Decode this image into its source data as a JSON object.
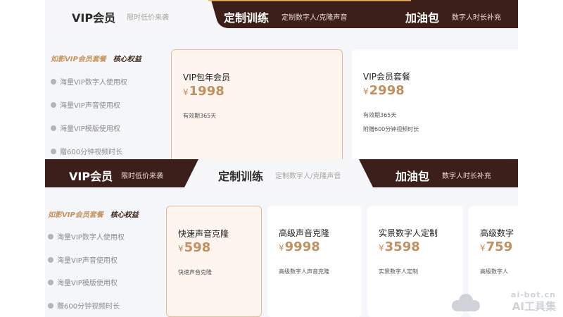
{
  "top": {
    "tabs": [
      {
        "title": "VIP会员",
        "subtitle": "限时低价来袭"
      },
      {
        "title": "定制训练",
        "subtitle": "定制数字人/克隆声音"
      },
      {
        "title": "加油包",
        "subtitle": "数字人时长补充"
      }
    ],
    "brand": "如影VIP会员套餐",
    "brand_core": "核心权益",
    "benefits": [
      "海量VIP数字人使用权",
      "海量VIP声音使用权",
      "海量VIP模版使用权",
      "赠600分钟视频时长"
    ],
    "cards": [
      {
        "name": "VIP包年会员",
        "currency": "¥",
        "price": "1998",
        "desc1": "有效期365天",
        "desc2": ""
      },
      {
        "name": "VIP会员套餐",
        "currency": "¥",
        "price": "2998",
        "desc1": "有效期365天",
        "desc2": "附赠600分钟视频时长"
      }
    ]
  },
  "bottom": {
    "tabs": [
      {
        "title": "VIP会员",
        "subtitle": "限时低价来袭"
      },
      {
        "title": "定制训练",
        "subtitle": "定制数字人/克隆声音"
      },
      {
        "title": "加油包",
        "subtitle": "数字人时长补充"
      }
    ],
    "brand": "如影VIP会员套餐",
    "brand_core": "核心权益",
    "benefits": [
      "海量VIP数字人使用权",
      "海量VIP声音使用权",
      "海量VIP模版使用权",
      "赠600分钟视频时长"
    ],
    "cards": [
      {
        "name": "快速声音克隆",
        "currency": "¥",
        "price": "598",
        "desc": "快速声音克隆"
      },
      {
        "name": "高级声音克隆",
        "currency": "¥",
        "price": "9998",
        "desc": "高级数字人声音克隆"
      },
      {
        "name": "实景数字人定制",
        "currency": "¥",
        "price": "3598",
        "desc": "实景数字人定制"
      },
      {
        "name": "高级数字",
        "currency": "¥",
        "price": "759",
        "desc": "高级数字人"
      }
    ]
  },
  "watermark": {
    "url": "ai-bot.cn",
    "name": "AI工具集"
  },
  "colors": {
    "dark_tab": "#3c1f1a",
    "panel": "#f5f6f9",
    "price": "#c28f61",
    "selected_border": "#e6bd98",
    "brand": "#c6945e"
  }
}
